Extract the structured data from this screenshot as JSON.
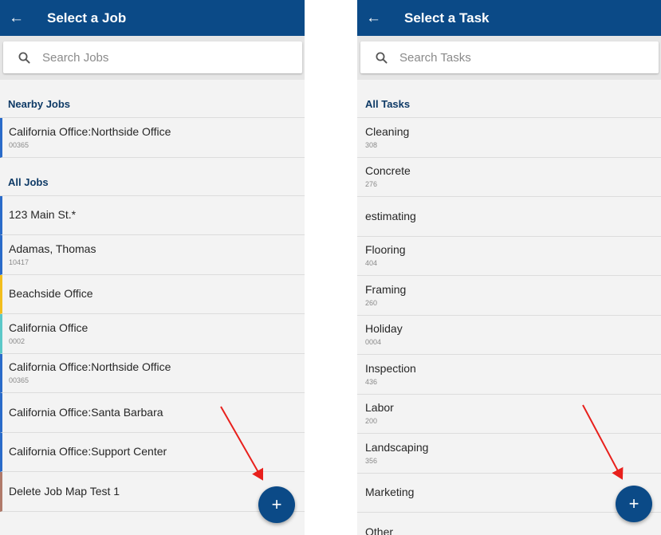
{
  "left": {
    "title": "Select a Job",
    "search_placeholder": "Search Jobs",
    "nearby_heading": "Nearby Jobs",
    "nearby": [
      {
        "name": "California Office:Northside Office",
        "code": "00365",
        "color": "#2a6bc9"
      }
    ],
    "all_heading": "All Jobs",
    "items": [
      {
        "name": "123 Main St.*",
        "code": "",
        "color": "#2a6bc9"
      },
      {
        "name": "Adamas, Thomas",
        "code": "10417",
        "color": "#2a6bc9"
      },
      {
        "name": "Beachside Office",
        "code": "",
        "color": "#f2be1d"
      },
      {
        "name": "California Office",
        "code": "0002",
        "color": "#5cc8c8"
      },
      {
        "name": "California Office:Northside Office",
        "code": "00365",
        "color": "#2a6bc9"
      },
      {
        "name": "California Office:Santa Barbara",
        "code": "",
        "color": "#2a6bc9"
      },
      {
        "name": "California Office:Support Center",
        "code": "",
        "color": "#2a6bc9"
      },
      {
        "name": "Delete Job Map Test 1",
        "code": "",
        "color": "#b07a6a"
      }
    ],
    "fab_label": "+"
  },
  "right": {
    "title": "Select a Task",
    "search_placeholder": "Search Tasks",
    "all_heading": "All Tasks",
    "items": [
      {
        "name": "Cleaning",
        "code": "308"
      },
      {
        "name": "Concrete",
        "code": "276"
      },
      {
        "name": "estimating",
        "code": ""
      },
      {
        "name": "Flooring",
        "code": "404"
      },
      {
        "name": "Framing",
        "code": "260"
      },
      {
        "name": "Holiday",
        "code": "0004"
      },
      {
        "name": "Inspection",
        "code": "436"
      },
      {
        "name": "Labor",
        "code": "200"
      },
      {
        "name": "Landscaping",
        "code": "356"
      },
      {
        "name": "Marketing",
        "code": ""
      },
      {
        "name": "Other",
        "code": ""
      }
    ],
    "fab_label": "+"
  },
  "icons": {
    "back": "arrow-left-icon",
    "search": "search-icon",
    "add": "plus-icon",
    "annotation": "red-arrow"
  },
  "colors": {
    "appbar": "#0b4a87",
    "heading": "#0e3a66",
    "annotation": "#e8201c"
  }
}
